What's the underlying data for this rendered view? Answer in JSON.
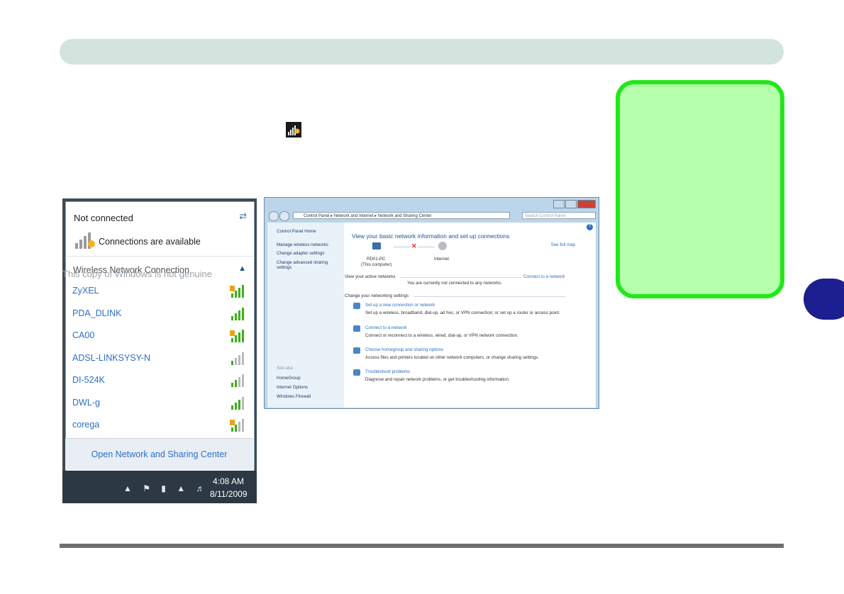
{
  "flyout": {
    "title": "Not connected",
    "connections_available": "Connections are available",
    "section_label": "Wireless Network Connection",
    "networks": [
      {
        "name": "ZyXEL",
        "secured": true
      },
      {
        "name": "PDA_DLINK",
        "secured": false
      },
      {
        "name": "CA00",
        "secured": true
      },
      {
        "name": "ADSL-LINKSYSY-N",
        "secured": false
      },
      {
        "name": "DI-524K",
        "secured": false
      },
      {
        "name": "DWL-g",
        "secured": false
      },
      {
        "name": "corega",
        "secured": true
      }
    ],
    "footer_link": "Open Network and Sharing Center"
  },
  "taskbar": {
    "watermark": "This copy of Windows is not genuine",
    "time": "4:08 AM",
    "date": "8/11/2009"
  },
  "control_panel": {
    "breadcrumb": [
      "Control Panel",
      "Network and Internet",
      "Network and Sharing Center"
    ],
    "search_placeholder": "Search Control Panel",
    "sidebar": {
      "home": "Control Panel Home",
      "links": [
        "Manage wireless networks",
        "Change adapter settings",
        "Change advanced sharing settings"
      ],
      "see_also": "See also",
      "see_also_links": [
        "HomeGroup",
        "Internet Options",
        "Windows Firewall"
      ]
    },
    "main": {
      "title": "View your basic network information and set up connections",
      "full_map": "See full map",
      "computer_name": "RD01-PC",
      "computer_sub": "(This computer)",
      "internet_label": "Internet",
      "active_label": "View your active networks",
      "connect_link": "Connect to a network",
      "not_connected": "You are currently not connected to any networks.",
      "change_label": "Change your networking settings",
      "settings": [
        {
          "link": "Set up a new connection or network",
          "desc": "Set up a wireless, broadband, dial-up, ad hoc, or VPN connection; or set up a router or access point."
        },
        {
          "link": "Connect to a network",
          "desc": "Connect or reconnect to a wireless, wired, dial-up, or VPN network connection."
        },
        {
          "link": "Choose homegroup and sharing options",
          "desc": "Access files and printers located on other network computers, or change sharing settings."
        },
        {
          "link": "Troubleshoot problems",
          "desc": "Diagnose and repair network problems, or get troubleshooting information."
        }
      ]
    }
  },
  "colors": {
    "header_bar": "#d3e3dd",
    "note_fill": "#b6ffad",
    "note_border": "#22e81a",
    "chapter_tab": "#1b1f8f",
    "link_blue": "#2c6fc4"
  }
}
